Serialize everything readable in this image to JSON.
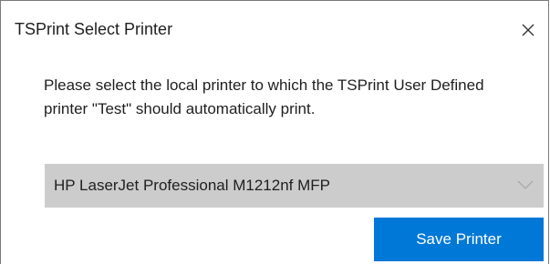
{
  "window": {
    "title": "TSPrint Select Printer",
    "close_icon": "close-icon"
  },
  "message": {
    "line1": "Please select the local printer to which the TSPrint User Defined",
    "line2": "printer \"Test\" should automatically print."
  },
  "printer_select": {
    "selected_value": "HP LaserJet Professional M1212nf MFP",
    "icon": "chevron-down-icon"
  },
  "actions": {
    "save_label": "Save Printer"
  },
  "colors": {
    "accent": "#0078d7",
    "select_background": "#cccccc"
  }
}
